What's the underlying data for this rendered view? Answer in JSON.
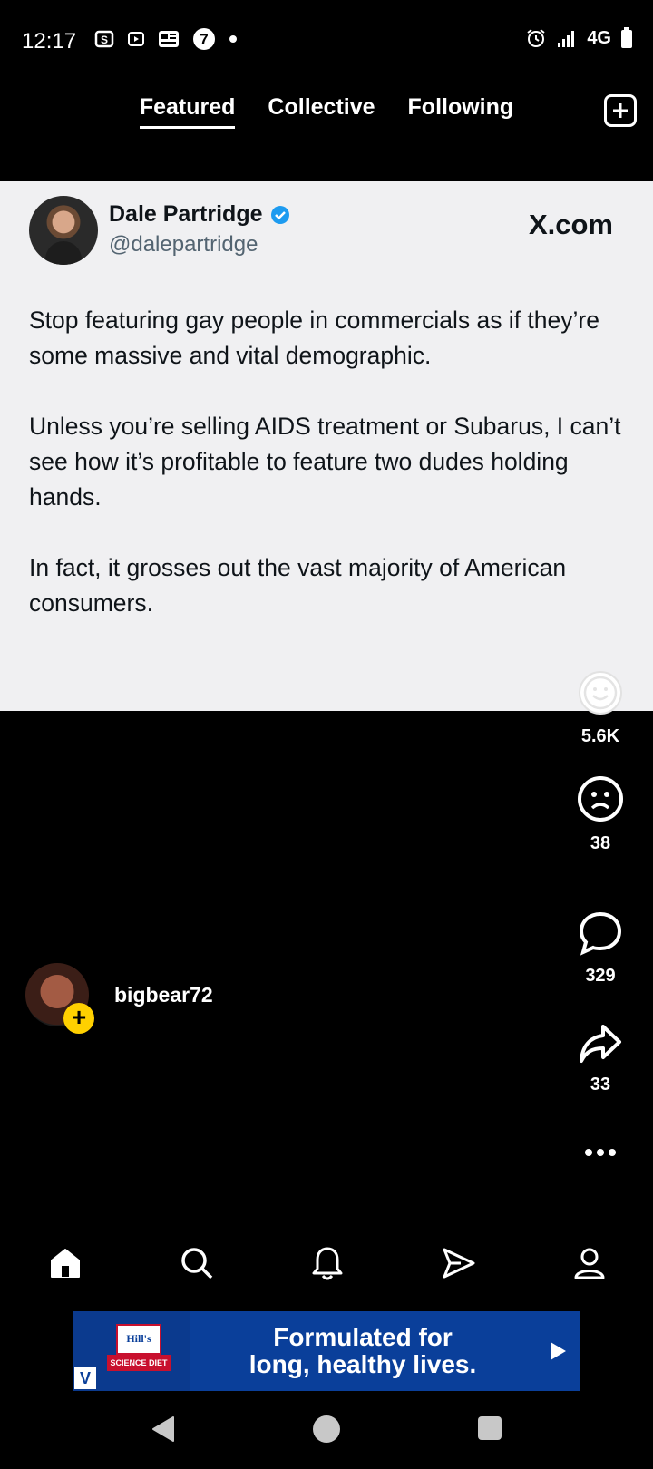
{
  "status_bar": {
    "time": "12:17",
    "network": "4G"
  },
  "top_tabs": {
    "tabs": [
      {
        "label": "Featured",
        "active": true
      },
      {
        "label": "Collective",
        "active": false
      },
      {
        "label": "Following",
        "active": false
      }
    ]
  },
  "tweet": {
    "author_name": "Dale Partridge",
    "author_handle": "@dalepartridge",
    "source": "X.com",
    "paragraphs": [
      "Stop featuring gay people in commercials as if they’re some massive and vital demographic.",
      "Unless you’re selling AIDS treatment or Subarus, I can’t see how it’s profitable to feature two dudes holding hands.",
      "In fact, it grosses out the vast majority of American consumers."
    ]
  },
  "actions": {
    "smile_count": "5.6K",
    "frown_count": "38",
    "comment_count": "329",
    "share_count": "33"
  },
  "creator": {
    "username": "bigbear72"
  },
  "ad": {
    "brand": "Hill's",
    "brand_sub": "SCIENCE DIET",
    "headline_line1": "Formulated for",
    "headline_line2": "long, healthy lives."
  },
  "colors": {
    "card_bg": "#f0f0f2",
    "verified": "#1d9bf0",
    "follow_badge": "#ffd000",
    "ad_bg": "#0a3f9a"
  }
}
